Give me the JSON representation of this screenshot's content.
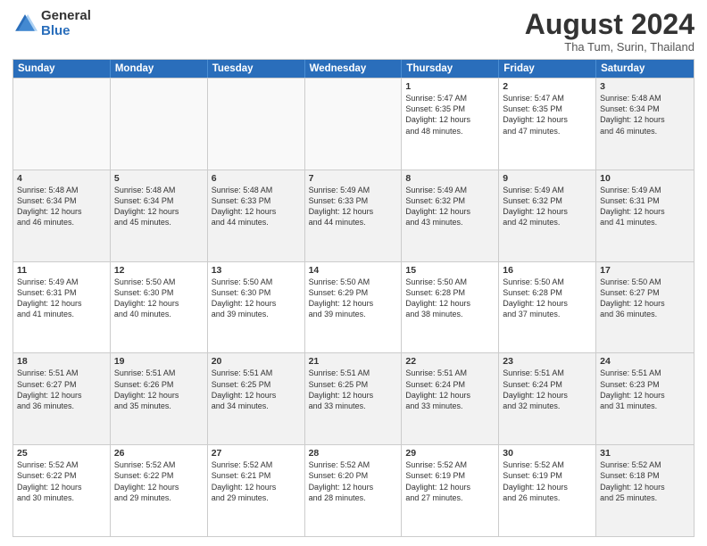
{
  "logo": {
    "general": "General",
    "blue": "Blue"
  },
  "title": "August 2024",
  "subtitle": "Tha Tum, Surin, Thailand",
  "days": [
    "Sunday",
    "Monday",
    "Tuesday",
    "Wednesday",
    "Thursday",
    "Friday",
    "Saturday"
  ],
  "weeks": [
    [
      {
        "day": "",
        "info": ""
      },
      {
        "day": "",
        "info": ""
      },
      {
        "day": "",
        "info": ""
      },
      {
        "day": "",
        "info": ""
      },
      {
        "day": "1",
        "info": "Sunrise: 5:47 AM\nSunset: 6:35 PM\nDaylight: 12 hours\nand 48 minutes."
      },
      {
        "day": "2",
        "info": "Sunrise: 5:47 AM\nSunset: 6:35 PM\nDaylight: 12 hours\nand 47 minutes."
      },
      {
        "day": "3",
        "info": "Sunrise: 5:48 AM\nSunset: 6:34 PM\nDaylight: 12 hours\nand 46 minutes."
      }
    ],
    [
      {
        "day": "4",
        "info": "Sunrise: 5:48 AM\nSunset: 6:34 PM\nDaylight: 12 hours\nand 46 minutes."
      },
      {
        "day": "5",
        "info": "Sunrise: 5:48 AM\nSunset: 6:34 PM\nDaylight: 12 hours\nand 45 minutes."
      },
      {
        "day": "6",
        "info": "Sunrise: 5:48 AM\nSunset: 6:33 PM\nDaylight: 12 hours\nand 44 minutes."
      },
      {
        "day": "7",
        "info": "Sunrise: 5:49 AM\nSunset: 6:33 PM\nDaylight: 12 hours\nand 44 minutes."
      },
      {
        "day": "8",
        "info": "Sunrise: 5:49 AM\nSunset: 6:32 PM\nDaylight: 12 hours\nand 43 minutes."
      },
      {
        "day": "9",
        "info": "Sunrise: 5:49 AM\nSunset: 6:32 PM\nDaylight: 12 hours\nand 42 minutes."
      },
      {
        "day": "10",
        "info": "Sunrise: 5:49 AM\nSunset: 6:31 PM\nDaylight: 12 hours\nand 41 minutes."
      }
    ],
    [
      {
        "day": "11",
        "info": "Sunrise: 5:49 AM\nSunset: 6:31 PM\nDaylight: 12 hours\nand 41 minutes."
      },
      {
        "day": "12",
        "info": "Sunrise: 5:50 AM\nSunset: 6:30 PM\nDaylight: 12 hours\nand 40 minutes."
      },
      {
        "day": "13",
        "info": "Sunrise: 5:50 AM\nSunset: 6:30 PM\nDaylight: 12 hours\nand 39 minutes."
      },
      {
        "day": "14",
        "info": "Sunrise: 5:50 AM\nSunset: 6:29 PM\nDaylight: 12 hours\nand 39 minutes."
      },
      {
        "day": "15",
        "info": "Sunrise: 5:50 AM\nSunset: 6:28 PM\nDaylight: 12 hours\nand 38 minutes."
      },
      {
        "day": "16",
        "info": "Sunrise: 5:50 AM\nSunset: 6:28 PM\nDaylight: 12 hours\nand 37 minutes."
      },
      {
        "day": "17",
        "info": "Sunrise: 5:50 AM\nSunset: 6:27 PM\nDaylight: 12 hours\nand 36 minutes."
      }
    ],
    [
      {
        "day": "18",
        "info": "Sunrise: 5:51 AM\nSunset: 6:27 PM\nDaylight: 12 hours\nand 36 minutes."
      },
      {
        "day": "19",
        "info": "Sunrise: 5:51 AM\nSunset: 6:26 PM\nDaylight: 12 hours\nand 35 minutes."
      },
      {
        "day": "20",
        "info": "Sunrise: 5:51 AM\nSunset: 6:25 PM\nDaylight: 12 hours\nand 34 minutes."
      },
      {
        "day": "21",
        "info": "Sunrise: 5:51 AM\nSunset: 6:25 PM\nDaylight: 12 hours\nand 33 minutes."
      },
      {
        "day": "22",
        "info": "Sunrise: 5:51 AM\nSunset: 6:24 PM\nDaylight: 12 hours\nand 33 minutes."
      },
      {
        "day": "23",
        "info": "Sunrise: 5:51 AM\nSunset: 6:24 PM\nDaylight: 12 hours\nand 32 minutes."
      },
      {
        "day": "24",
        "info": "Sunrise: 5:51 AM\nSunset: 6:23 PM\nDaylight: 12 hours\nand 31 minutes."
      }
    ],
    [
      {
        "day": "25",
        "info": "Sunrise: 5:52 AM\nSunset: 6:22 PM\nDaylight: 12 hours\nand 30 minutes."
      },
      {
        "day": "26",
        "info": "Sunrise: 5:52 AM\nSunset: 6:22 PM\nDaylight: 12 hours\nand 29 minutes."
      },
      {
        "day": "27",
        "info": "Sunrise: 5:52 AM\nSunset: 6:21 PM\nDaylight: 12 hours\nand 29 minutes."
      },
      {
        "day": "28",
        "info": "Sunrise: 5:52 AM\nSunset: 6:20 PM\nDaylight: 12 hours\nand 28 minutes."
      },
      {
        "day": "29",
        "info": "Sunrise: 5:52 AM\nSunset: 6:19 PM\nDaylight: 12 hours\nand 27 minutes."
      },
      {
        "day": "30",
        "info": "Sunrise: 5:52 AM\nSunset: 6:19 PM\nDaylight: 12 hours\nand 26 minutes."
      },
      {
        "day": "31",
        "info": "Sunrise: 5:52 AM\nSunset: 6:18 PM\nDaylight: 12 hours\nand 25 minutes."
      }
    ]
  ]
}
